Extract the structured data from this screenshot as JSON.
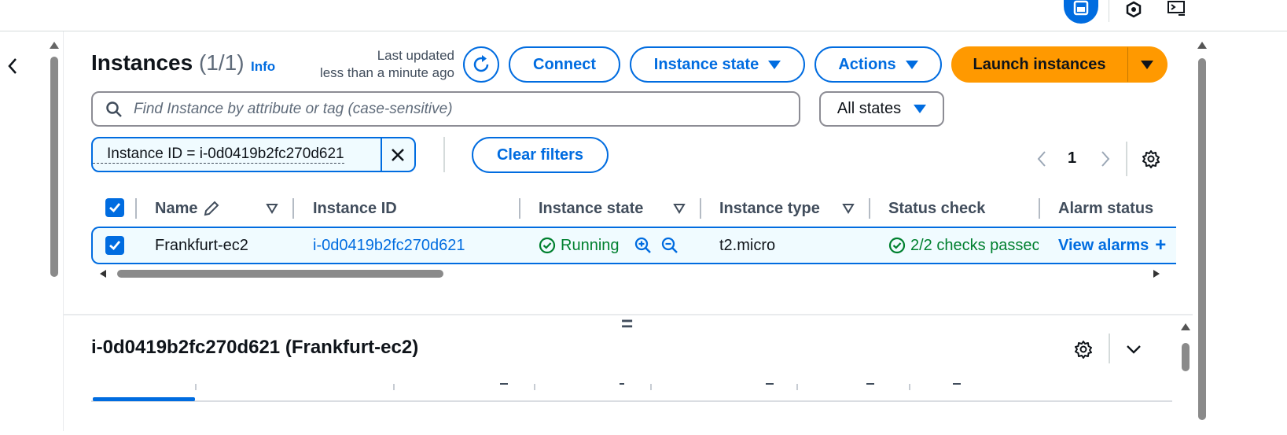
{
  "top_icons": [
    "window-icon",
    "hexagon-icon",
    "terminal-icon"
  ],
  "header": {
    "title": "Instances",
    "count": "(1/1)",
    "info_label": "Info",
    "last_updated_line1": "Last updated",
    "last_updated_line2": "less than a minute ago"
  },
  "toolbar": {
    "connect_label": "Connect",
    "instance_state_label": "Instance state",
    "actions_label": "Actions",
    "launch_label": "Launch instances"
  },
  "search": {
    "placeholder": "Find Instance by attribute or tag (case-sensitive)",
    "state_filter": "All states"
  },
  "filter": {
    "token": "Instance ID = i-0d0419b2fc270d621",
    "clear_label": "Clear filters"
  },
  "pagination": {
    "page": "1"
  },
  "table": {
    "columns": [
      "Name",
      "Instance ID",
      "Instance state",
      "Instance type",
      "Status check",
      "Alarm status"
    ],
    "rows": [
      {
        "name": "Frankfurt-ec2",
        "instance_id": "i-0d0419b2fc270d621",
        "state": "Running",
        "type": "t2.micro",
        "status_check": "2/2 checks passec",
        "alarm": "View alarms",
        "alarm_add": "+"
      }
    ]
  },
  "details": {
    "title": "i-0d0419b2fc270d621 (Frankfurt-ec2)",
    "resize_handle": "="
  },
  "colors": {
    "accent": "#006ce0",
    "launch": "#ff9900",
    "running": "#00802f"
  }
}
